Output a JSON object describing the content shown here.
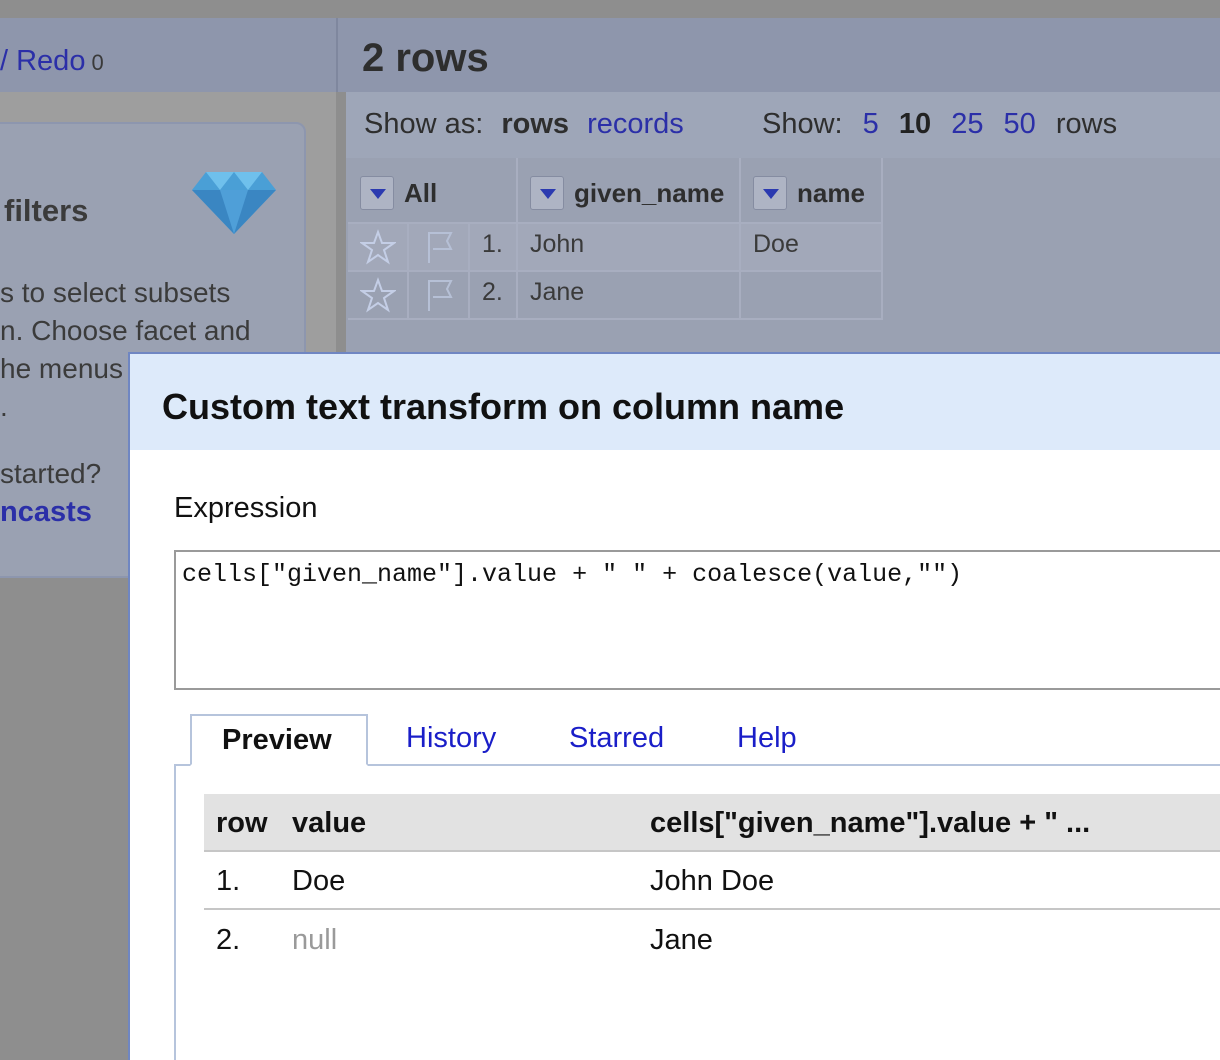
{
  "left": {
    "undo_redo_label": "/ Redo",
    "undo_redo_count": "0",
    "facet_title": "filters",
    "facet_lines": [
      "s to select subsets",
      "n. Choose facet and",
      "he menus",
      "."
    ],
    "started_text": "started?",
    "screencasts_link": "ncasts"
  },
  "grid": {
    "title": "2 rows",
    "show_as_label": "Show as:",
    "show_as_rows": "rows",
    "show_as_records": "records",
    "show_label": "Show:",
    "page_sizes": [
      "5",
      "10",
      "25",
      "50"
    ],
    "page_size_selected": "10",
    "rows_suffix": "rows",
    "columns": [
      "All",
      "given_name",
      "name"
    ],
    "rows": [
      {
        "index": "1.",
        "given_name": "John",
        "name": "Doe"
      },
      {
        "index": "2.",
        "given_name": "Jane",
        "name": ""
      }
    ]
  },
  "dialog": {
    "title": "Custom text transform on column name",
    "expression_label": "Expression",
    "expression": "cells[\"given_name\"].value + \" \" + coalesce(value,\"\")",
    "tabs": [
      "Preview",
      "History",
      "Starred",
      "Help"
    ],
    "active_tab": "Preview",
    "preview": {
      "headers": [
        "row",
        "value",
        "cells[\"given_name\"].value + \" ..."
      ],
      "rows": [
        {
          "row": "1.",
          "value": "Doe",
          "result": "John Doe"
        },
        {
          "row": "2.",
          "value": "null",
          "result": "Jane"
        }
      ]
    }
  },
  "colors": {
    "link": "#2b2fa8",
    "tab_link": "#1a1ec8",
    "dialog_header": "#ddeafa",
    "overlay_panel": "#9aa1b2"
  }
}
